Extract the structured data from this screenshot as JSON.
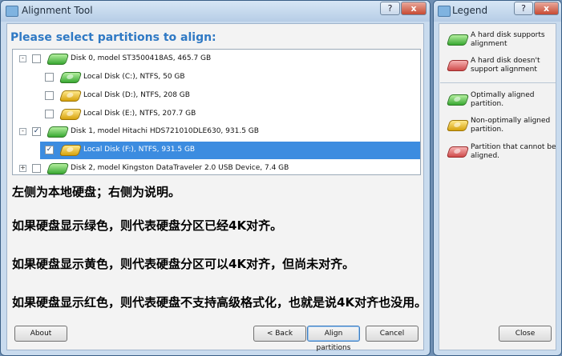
{
  "main_window": {
    "title": "Alignment Tool",
    "help_label": "?",
    "close_label": "x",
    "heading": "Please select partitions to align:",
    "tree": [
      {
        "level": 0,
        "expander": "-",
        "checked": false,
        "icon": "green",
        "label": "Disk 0, model ST3500418AS, 465.7 GB"
      },
      {
        "level": 1,
        "checked": false,
        "icon": "green",
        "label": "Local Disk (C:), NTFS, 50 GB"
      },
      {
        "level": 1,
        "checked": false,
        "icon": "gold",
        "label": "Local Disk (D:), NTFS, 208 GB"
      },
      {
        "level": 1,
        "checked": false,
        "icon": "gold",
        "label": "Local Disk (E:), NTFS, 207.7 GB"
      },
      {
        "level": 0,
        "expander": "-",
        "checked": true,
        "icon": "green",
        "label": "Disk 1, model Hitachi HDS721010DLE630, 931.5 GB"
      },
      {
        "level": 1,
        "checked": true,
        "icon": "gold",
        "label": "Local Disk (F:), NTFS, 931.5 GB",
        "selected": true
      },
      {
        "level": 0,
        "expander": "+",
        "checked": false,
        "icon": "green",
        "label": "Disk 2, model Kingston DataTraveler 2.0 USB Device, 7.4 GB"
      }
    ],
    "overlay_text": [
      "左侧为本地硬盘；右侧为说明。",
      "如果硬盘显示绿色，则代表硬盘分区已经4K对齐。",
      "如果硬盘显示黄色，则代表硬盘分区可以4K对齐，但尚未对齐。",
      "如果硬盘显示红色，则代表硬盘不支持高级格式化，也就是说4K对齐也没用。"
    ],
    "buttons": {
      "about": "About",
      "back": "< Back",
      "align": "Align partitions",
      "cancel": "Cancel"
    }
  },
  "legend_window": {
    "title": "Legend",
    "help_label": "?",
    "close_label": "x",
    "items": [
      {
        "icon": "green",
        "text": "A hard disk supports alignment"
      },
      {
        "icon": "red",
        "text": "A hard disk doesn't support alignment"
      },
      {
        "icon": "green",
        "text": "Optimally aligned partition."
      },
      {
        "icon": "gold",
        "text": "Non-optimally aligned partition."
      },
      {
        "icon": "red",
        "text": "Partition that cannot be aligned."
      }
    ],
    "close_button": "Close"
  },
  "colors": {
    "heading": "#2f79c4",
    "selection": "#3c8ce0",
    "green": "#39a832",
    "gold": "#d6a20c",
    "red": "#cf4b4b"
  }
}
